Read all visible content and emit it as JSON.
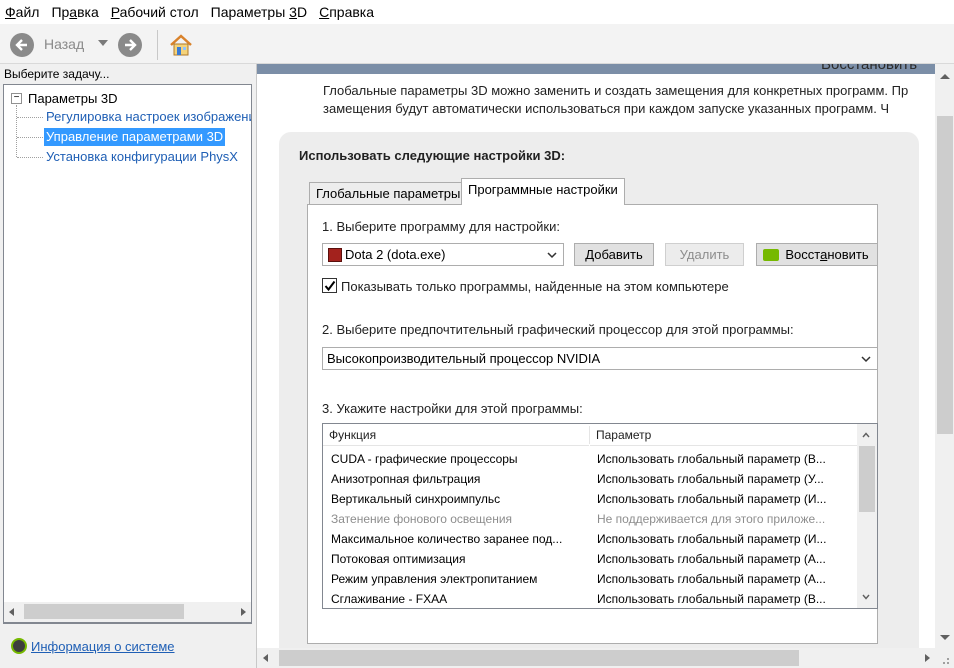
{
  "menu": {
    "items": [
      {
        "pre": "",
        "mn": "Ф",
        "post": "айл"
      },
      {
        "pre": "Пр",
        "mn": "а",
        "post": "вка"
      },
      {
        "pre": "",
        "mn": "Р",
        "post": "абочий стол"
      },
      {
        "pre": "Параметры ",
        "mn": "3",
        "post": "D"
      },
      {
        "pre": "",
        "mn": "С",
        "post": "правка"
      }
    ]
  },
  "toolbar": {
    "back_label": "Назад",
    "icons": {
      "back": "back-arrow-icon",
      "forward": "forward-arrow-icon",
      "home": "home-icon"
    }
  },
  "left": {
    "header": "Выберите задачу...",
    "tree": {
      "root": "Параметры 3D",
      "children": [
        {
          "label": "Регулировка настроек изображения"
        },
        {
          "label": "Управление параметрами 3D",
          "selected": true
        },
        {
          "label": "Установка конфигурации PhysX"
        }
      ]
    },
    "sysinfo_link": "Информация о системе"
  },
  "right": {
    "banner_title": "Восстановить",
    "description_lines": [
      "Глобальные параметры 3D можно заменить и создать замещения для конкретных программ. Пр",
      "замещения будут автоматически использоваться при каждом запуске указанных программ. Ч"
    ],
    "panel_title": "Использовать следующие настройки 3D:",
    "tabs": [
      {
        "label": "Глобальные параметры",
        "active": false
      },
      {
        "label": "Программные настройки",
        "active": true
      }
    ],
    "step1_label": "1. Выберите программу для настройки:",
    "program_select": "Dota 2 (dota.exe)",
    "add_button": "Добавить",
    "remove_button": "Удалить",
    "restore_button": {
      "pre": "Восст",
      "mn": "а",
      "post": "новить"
    },
    "show_only_found": {
      "label": "Показывать только программы, найденные на этом компьютере",
      "checked": true
    },
    "step2_label": "2. Выберите предпочтительный графический процессор для этой программы:",
    "gpu_select": "Высокопроизводительный процессор NVIDIA",
    "step3_label": "3. Укажите настройки для этой программы:",
    "table": {
      "headers": [
        "Функция",
        "Параметр"
      ],
      "rows": [
        {
          "feature": "CUDA - графические процессоры",
          "value": "Использовать глобальный параметр (В...",
          "disabled": false
        },
        {
          "feature": "Анизотропная фильтрация",
          "value": "Использовать глобальный параметр (У...",
          "disabled": false
        },
        {
          "feature": "Вертикальный синхроимпульс",
          "value": "Использовать глобальный параметр (И...",
          "disabled": false
        },
        {
          "feature": "Затенение фонового освещения",
          "value": "Не поддерживается для этого приложе...",
          "disabled": true
        },
        {
          "feature": "Максимальное количество заранее под...",
          "value": "Использовать глобальный параметр (И...",
          "disabled": false
        },
        {
          "feature": "Потоковая оптимизация",
          "value": "Использовать глобальный параметр (А...",
          "disabled": false
        },
        {
          "feature": "Режим управления электропитанием",
          "value": "Использовать глобальный параметр (А...",
          "disabled": false
        },
        {
          "feature": "Сглаживание - FXAA",
          "value": "Использовать глобальный параметр (В...",
          "disabled": false
        }
      ]
    }
  },
  "colors": {
    "link": "#1f5fb5",
    "selection": "#3399ff",
    "nvidia_green": "#76b900",
    "banner": "#7b8ea7"
  }
}
